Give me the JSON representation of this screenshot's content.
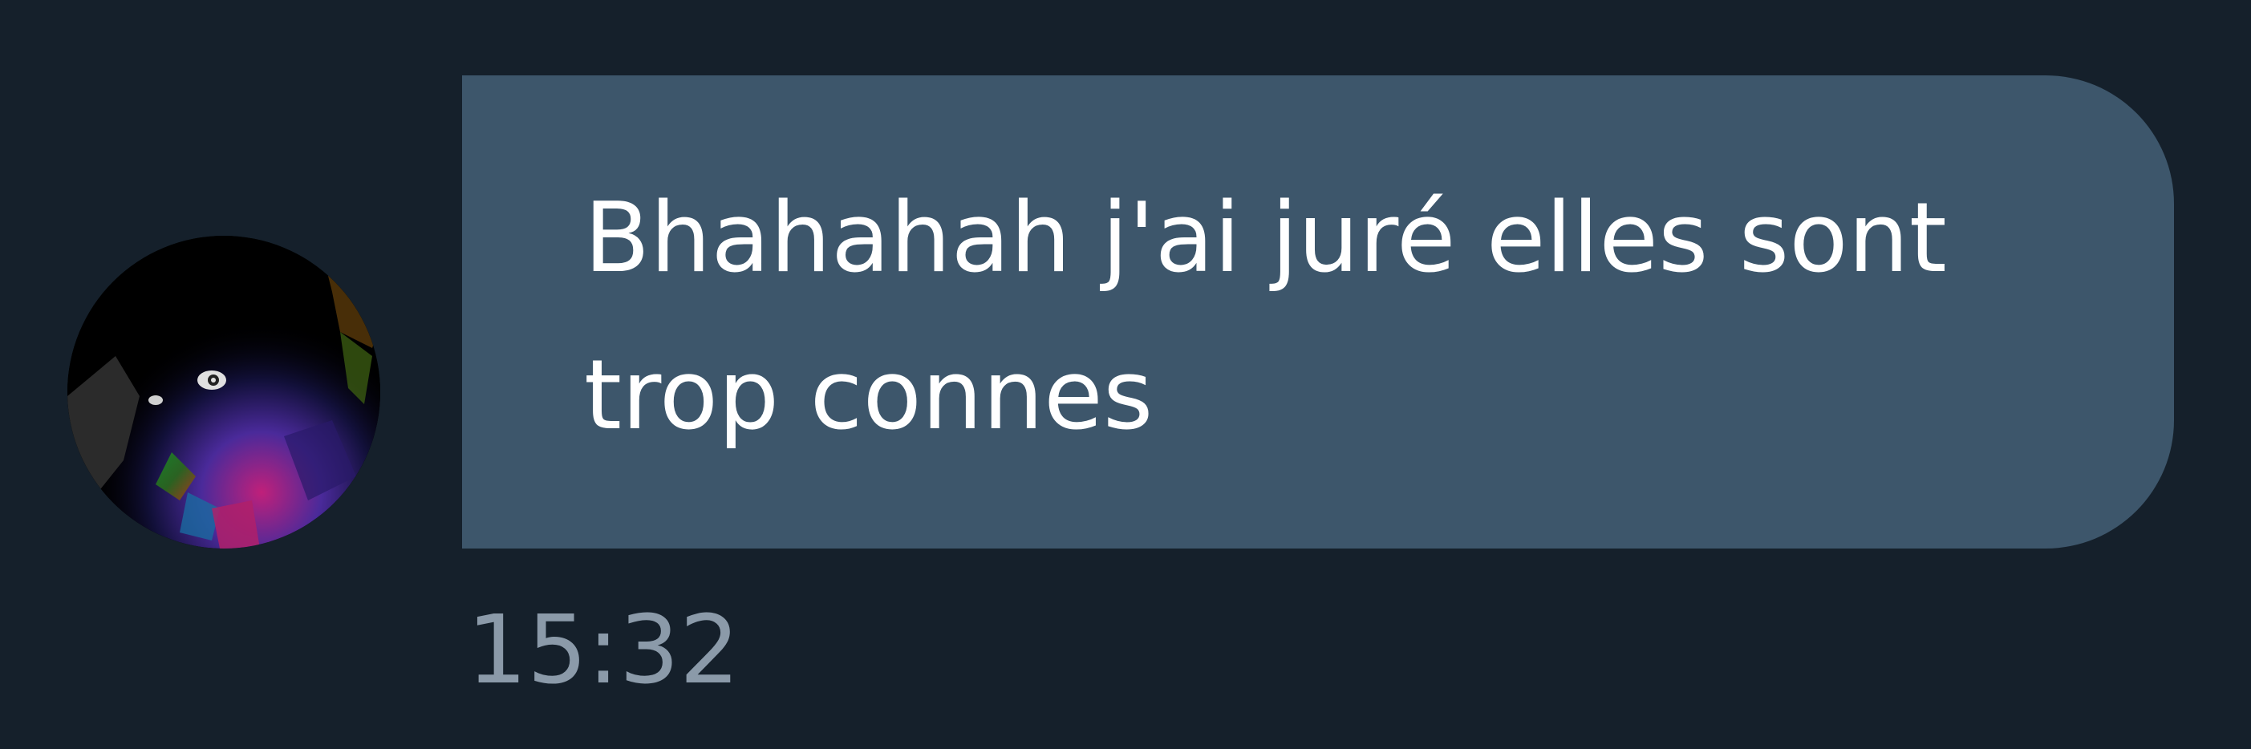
{
  "conversation": {
    "message": {
      "text": "Bhahahah j'ai juré elles sont trop connes",
      "timestamp": "15:32"
    },
    "sender": {
      "avatar_icon": "profile-avatar"
    }
  },
  "colors": {
    "background": "#15202b",
    "bubble": "#3d566b",
    "message_text": "#ffffff",
    "timestamp_text": "#8b9aa9"
  }
}
